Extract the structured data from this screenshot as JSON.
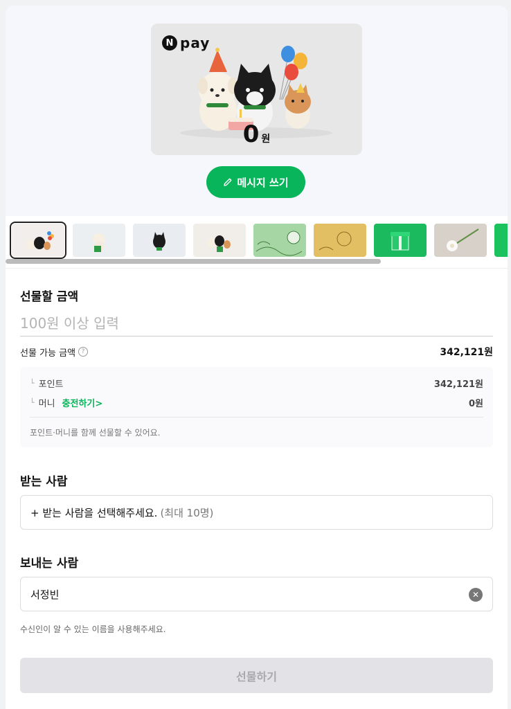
{
  "card": {
    "brand_badge": "N",
    "brand_name": "pay",
    "amount": "0",
    "amount_unit": "원"
  },
  "message_button": {
    "label": "메시지 쓰기",
    "icon": "pencil-icon"
  },
  "thumbnails": [
    {
      "name": "characters-party",
      "selected": true,
      "colors": [
        "#f3f1ef",
        "#e7e4e0"
      ]
    },
    {
      "name": "bear-gift",
      "selected": false,
      "colors": [
        "#eef0f3",
        "#e2e6ea"
      ]
    },
    {
      "name": "cat-sitting",
      "selected": false,
      "colors": [
        "#eceef1",
        "#e0e3e8"
      ]
    },
    {
      "name": "characters-gift",
      "selected": false,
      "colors": [
        "#f2efec",
        "#e7e2dc"
      ]
    },
    {
      "name": "green-illustration",
      "selected": false,
      "colors": [
        "#a9d8a7",
        "#7fbf7c"
      ]
    },
    {
      "name": "gold-illustration",
      "selected": false,
      "colors": [
        "#e6c268",
        "#cfa23c"
      ]
    },
    {
      "name": "green-giftbox",
      "selected": false,
      "colors": [
        "#26c76a",
        "#0fa555"
      ]
    },
    {
      "name": "white-flower",
      "selected": false,
      "colors": [
        "#dad3cb",
        "#c9c0b6"
      ]
    },
    {
      "name": "green-partial",
      "selected": false,
      "colors": [
        "#1bc25e",
        "#0fa555"
      ]
    }
  ],
  "amount_section": {
    "title": "선물할 금액",
    "placeholder": "100원 이상 입력",
    "available_label": "선물 가능 금액",
    "available_value": "342,121원",
    "points_label": "포인트",
    "points_value": "342,121원",
    "money_label": "머니",
    "charge_link": "충전하기",
    "money_value": "0원",
    "note": "포인트·머니를 함께 선물할 수 있어요."
  },
  "recipient": {
    "title": "받는 사람",
    "add_text": "+ 받는 사람을 선택해주세요.",
    "max_text": "(최대 10명)"
  },
  "sender": {
    "title": "보내는 사람",
    "value": "서정빈",
    "hint": "수신인이 알 수 있는 이름을 사용해주세요."
  },
  "gift_button": {
    "label": "선물하기"
  },
  "colors": {
    "accent": "#08b55a",
    "disabled_bg": "#e3e3e7",
    "disabled_text": "#a9a9ad"
  }
}
